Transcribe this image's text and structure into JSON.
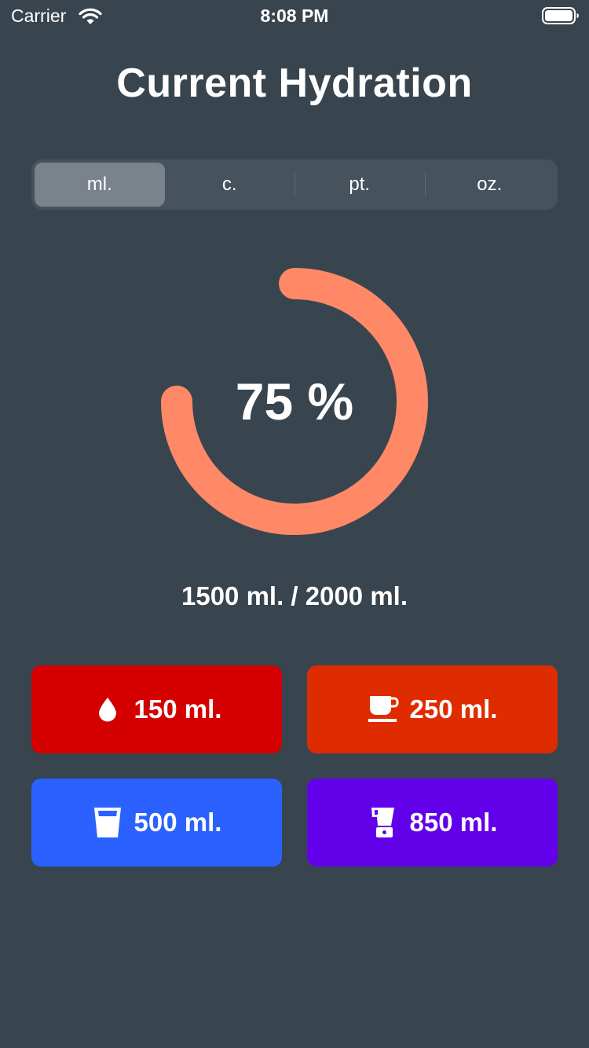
{
  "status_bar": {
    "carrier": "Carrier",
    "time": "8:08 PM"
  },
  "title": "Current Hydration",
  "units": {
    "options": [
      "ml.",
      "c.",
      "pt.",
      "oz."
    ],
    "selected": "ml."
  },
  "progress": {
    "percent": 75,
    "label": "75 %",
    "color": "#ff8866"
  },
  "summary": "1500 ml. / 2000 ml.",
  "buttons": [
    {
      "label": "150 ml.",
      "icon": "water-drop-icon",
      "color": "#d40000"
    },
    {
      "label": "250 ml.",
      "icon": "coffee-cup-icon",
      "color": "#de2c00"
    },
    {
      "label": "500 ml.",
      "icon": "glass-icon",
      "color": "#2b62ff"
    },
    {
      "label": "850 ml.",
      "icon": "blender-icon",
      "color": "#6200ea"
    }
  ],
  "background": "#38454f"
}
